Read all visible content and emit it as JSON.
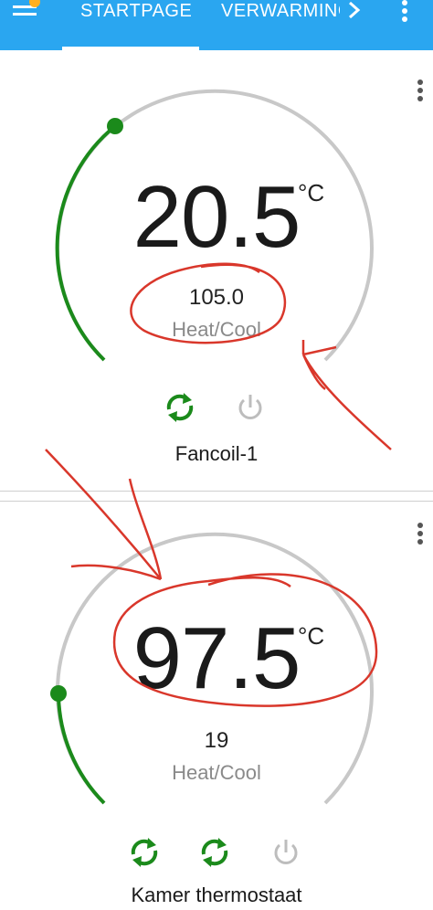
{
  "colors": {
    "appbar": "#2aa6f0",
    "active_arc": "#1b8a1b",
    "track": "#c8c8c8",
    "annotation": "#d9372b"
  },
  "tabs": [
    {
      "label": "STARTPAGE",
      "active": true
    },
    {
      "label": "VERWARMING",
      "active": false
    }
  ],
  "icons": {
    "menu": "menu-icon",
    "next": "chevron-right-icon",
    "more": "more-vert-icon",
    "sync": "sync-icon",
    "power": "power-icon"
  },
  "cards": [
    {
      "temperature": "20.5",
      "unit": "°C",
      "value": "105.0",
      "mode": "Heat/Cool",
      "name": "Fancoil-1",
      "level_fraction": 0.3
    },
    {
      "temperature": "97.5",
      "unit": "°C",
      "value": "19",
      "mode": "Heat/Cool",
      "name": "Kamer thermostaat",
      "level_fraction": 0.15
    }
  ]
}
